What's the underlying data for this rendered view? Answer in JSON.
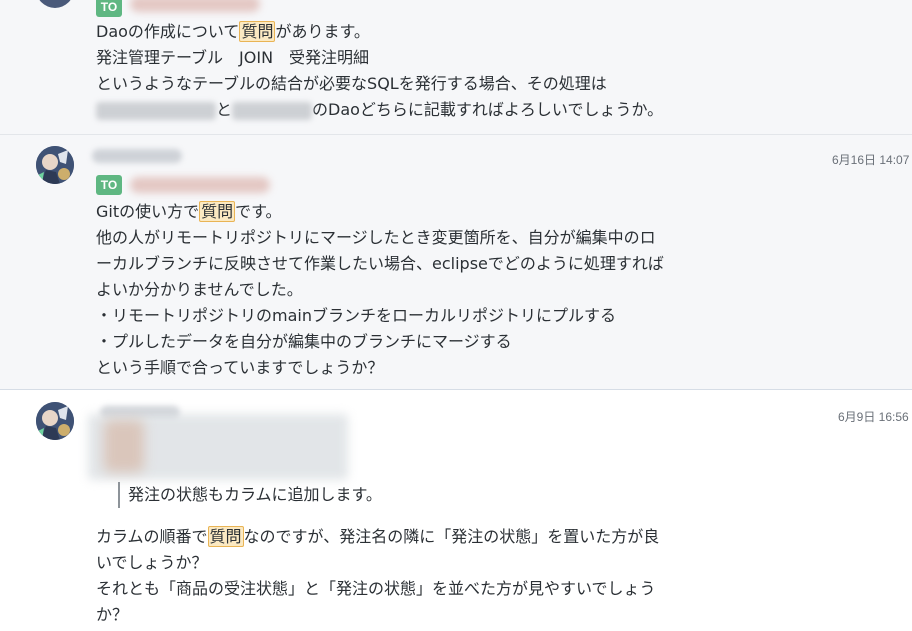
{
  "messages": [
    {
      "to": "TO",
      "lines": {
        "l1_pre": "Daoの作成について",
        "l1_hl": "質問",
        "l1_post": "があります。",
        "l2": "発注管理テーブル　JOIN　受発注明細",
        "l3": "というようなテーブルの結合が必要なSQLを発行する場合、その処理は",
        "l4_mid": "と",
        "l4_post": "のDaoどちらに記載すればよろしいでしょうか。"
      }
    },
    {
      "time": "6月16日 14:07",
      "to": "TO",
      "lines": {
        "l1_pre": "Gitの使い方で",
        "l1_hl": "質問",
        "l1_post": "です。",
        "l2": "他の人がリモートリポジトリにマージしたとき変更箇所を、自分が編集中のロ",
        "l3": "ーカルブランチに反映させて作業したい場合、eclipseでどのように処理すれば",
        "l4": "よいか分かりませんでした。",
        "l5": "・リモートリポジトリのmainブランチをローカルリポジトリにプルする",
        "l6": "・プルしたデータを自分が編集中のブランチにマージする",
        "l7": "という手順で合っていますでしょうか？"
      }
    },
    {
      "time": "6月9日 16:56",
      "quote": "発注の状態もカラムに追加します。",
      "lines": {
        "l1_pre": "カラムの順番で",
        "l1_hl": "質問",
        "l1_post": "なのですが、発注名の隣に「発注の状態」を置いた方が良",
        "l2": "いでしょうか？",
        "l3": "それとも「商品の受注状態」と「発注の状態」を並べた方が見やすいでしょう",
        "l4": "か？"
      }
    }
  ],
  "colors": {
    "to_badge": "#5fb782",
    "highlight_bg": "#fbe9c2",
    "highlight_border": "#e9b455"
  }
}
